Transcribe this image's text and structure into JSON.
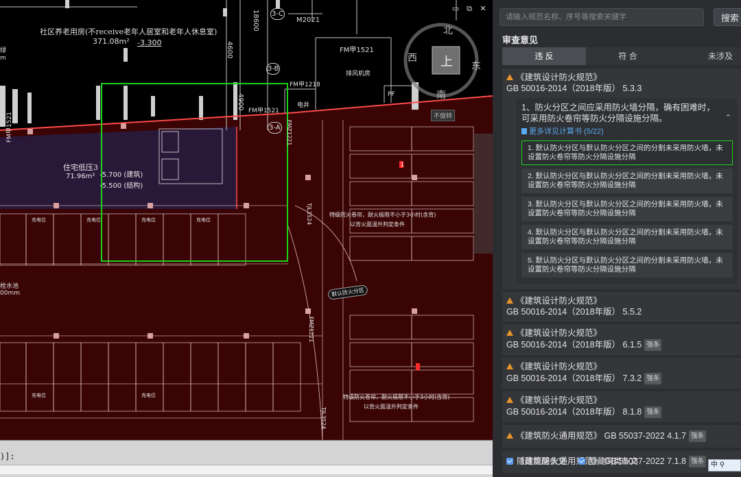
{
  "cad": {
    "window_controls": [
      "▭",
      "⧉",
      "✕"
    ],
    "labels": {
      "room_elderly": "社区养老用房(不receive老年人居室和老年人休息室)",
      "room_elderly_area": "371.08m²",
      "room_elderly_level": "-3.300",
      "dim_4600": "4600",
      "dim_4900": "4900",
      "dim_18600": "18600",
      "axis_3c": "3-C",
      "axis_3b": "3-B",
      "axis_3a": "3-A",
      "door_m2021": "M2021",
      "door_fmjia1521_a": "FM甲1521",
      "door_fmjia1218": "FM甲1218",
      "door_fmjia1521_b": "FM甲1521",
      "room_fan": "排风机房",
      "room_elec": "电井",
      "room_pf": "PF",
      "room_pressure": "住宅低压3",
      "room_pressure_area": "71.96m²",
      "room_pressure_lv1": "-5.700 (建筑)",
      "room_pressure_lv2": "-5.500 (结构)",
      "fire_note_1": "特级防火卷帘，耐火极限不小于3小时(含背)",
      "fire_note_1b": "以背火面温升判定条件",
      "fire_note_2": "特级防火卷帘，耐火极限不小于3小时(含背)",
      "fire_note_2b": "以背火面温升判定条件",
      "zone_tag": "默认防火分区",
      "fm_left": "FM甲1521",
      "fmz_1": "FMZ1221",
      "fmz_2": "FMZ1221",
      "tjl_1": "TJL3524",
      "tjl_2": "TJL3524",
      "left_frag_1": "绿",
      "left_frag_2": "m",
      "left_frag_3": "栓水池",
      "left_frag_4": "00mm",
      "charge_label": "充电位",
      "marker_1": "1"
    },
    "compass": {
      "north": "北",
      "south": "南",
      "east": "东",
      "west": "西",
      "up": "上",
      "view": "不旋转"
    }
  },
  "command_line": {
    "text": ")]:"
  },
  "panel": {
    "search": {
      "placeholder": "请输入规范名称、序号等搜索关键字",
      "button": "搜索"
    },
    "section_title": "审查意见",
    "tabs": [
      {
        "label": "违 反",
        "active": true
      },
      {
        "label": "符 合",
        "active": false
      },
      {
        "label": "未涉及",
        "active": false
      }
    ],
    "clauses": [
      {
        "title": "《建筑设计防火规范》",
        "code": "GB 50016-2014（2018年版） 5.3.3",
        "badge": "",
        "expanded": true,
        "detail": {
          "desc": "1、防火分区之间应采用防火墙分隔，确有困难时，可采用防火卷帘等防火分隔设施分隔。",
          "link": "更多详见计算书 (5/22)",
          "items": [
            "1. 默认防火分区与默认防火分区之间的分割未采用防火墙，未设置防火卷帘等防火分隔设施分隔",
            "2. 默认防火分区与默认防火分区之间的分割未采用防火墙，未设置防火卷帘等防火分隔设施分隔",
            "3. 默认防火分区与默认防火分区之间的分割未采用防火墙，未设置防火卷帘等防火分隔设施分隔",
            "4. 默认防火分区与默认防火分区之间的分割未采用防火墙，未设置防火卷帘等防火分隔设施分隔",
            "5. 默认防火分区与默认防火分区之间的分割未采用防火墙，未设置防火卷帘等防火分隔设施分隔"
          ]
        }
      },
      {
        "title": "《建筑设计防火规范》",
        "code": "GB 50016-2014（2018年版） 5.5.2",
        "badge": ""
      },
      {
        "title": "《建筑设计防火规范》",
        "code": "GB 50016-2014（2018年版） 6.1.5",
        "badge": "强条"
      },
      {
        "title": "《建筑设计防火规范》",
        "code": "GB 50016-2014（2018年版） 7.3.2",
        "badge": "强条"
      },
      {
        "title": "《建筑设计防火规范》",
        "code": "GB 50016-2014（2018年版） 8.1.8",
        "badge": "强条"
      },
      {
        "title": "《建筑防火通用规范》",
        "code": "GB 55037-2022 4.1.7",
        "badge": "强条",
        "inline": true
      },
      {
        "title": "《建筑防火通用规范》",
        "code": "GB 55037-2022 7.1.8",
        "badge": "强条",
        "inline": true
      }
    ],
    "options": [
      {
        "label": "隐藏提醒条文",
        "checked": true
      },
      {
        "label": "隐藏同类条文",
        "checked": true
      }
    ],
    "ime": "中 ⚲"
  },
  "colors": {
    "accent_green": "#1bd21b",
    "warn_orange": "#e8952b",
    "link_blue": "#5aa9f0",
    "cad_red_fill": "#3a0404",
    "cad_purple_fill": "#2a1838"
  }
}
